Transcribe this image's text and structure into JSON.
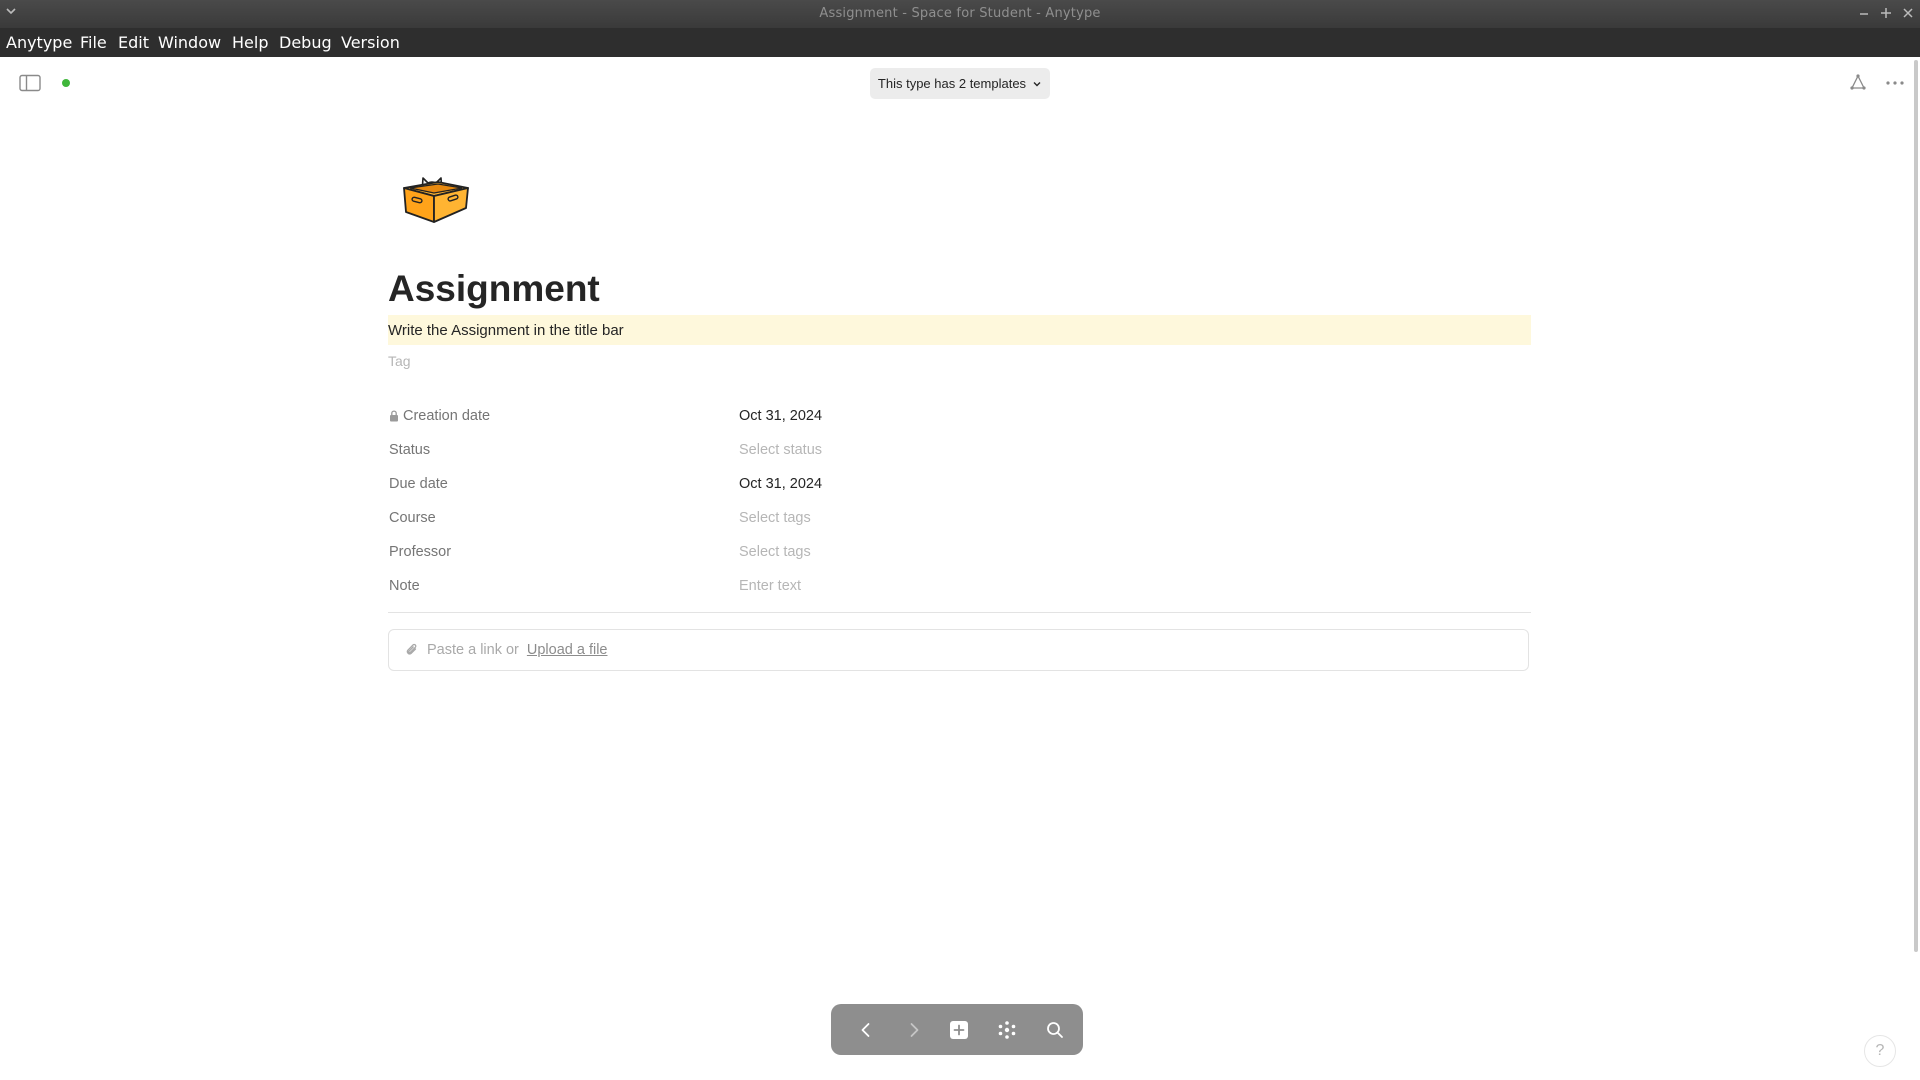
{
  "window": {
    "title": "Assignment - Space for Student - Anytype"
  },
  "menubar": {
    "items": [
      "Anytype",
      "File",
      "Edit",
      "Window",
      "Help",
      "Debug",
      "Version"
    ]
  },
  "toolbar": {
    "template_label": "This type has 2 templates",
    "sync_status_color": "#3fb63b"
  },
  "page": {
    "icon": "box-with-cat-icon",
    "title": "Assignment",
    "description": "Write the Assignment in the title bar",
    "tag_placeholder": "Tag"
  },
  "relations": [
    {
      "name": "Creation date",
      "value": "Oct 31, 2024",
      "locked": true,
      "empty": false
    },
    {
      "name": "Status",
      "value": "Select status",
      "locked": false,
      "empty": true
    },
    {
      "name": "Due date",
      "value": "Oct 31, 2024",
      "locked": false,
      "empty": false
    },
    {
      "name": "Course",
      "value": "Select tags",
      "locked": false,
      "empty": true
    },
    {
      "name": "Professor",
      "value": "Select tags",
      "locked": false,
      "empty": true
    },
    {
      "name": "Note",
      "value": "Enter text",
      "locked": false,
      "empty": true
    }
  ],
  "attachment": {
    "prefix": "Paste a link or",
    "link": "Upload a file"
  },
  "bottom_nav": {
    "icons": [
      "back-icon",
      "forward-icon",
      "plus-icon",
      "graph-icon",
      "search-icon"
    ]
  },
  "help": {
    "label": "?"
  }
}
